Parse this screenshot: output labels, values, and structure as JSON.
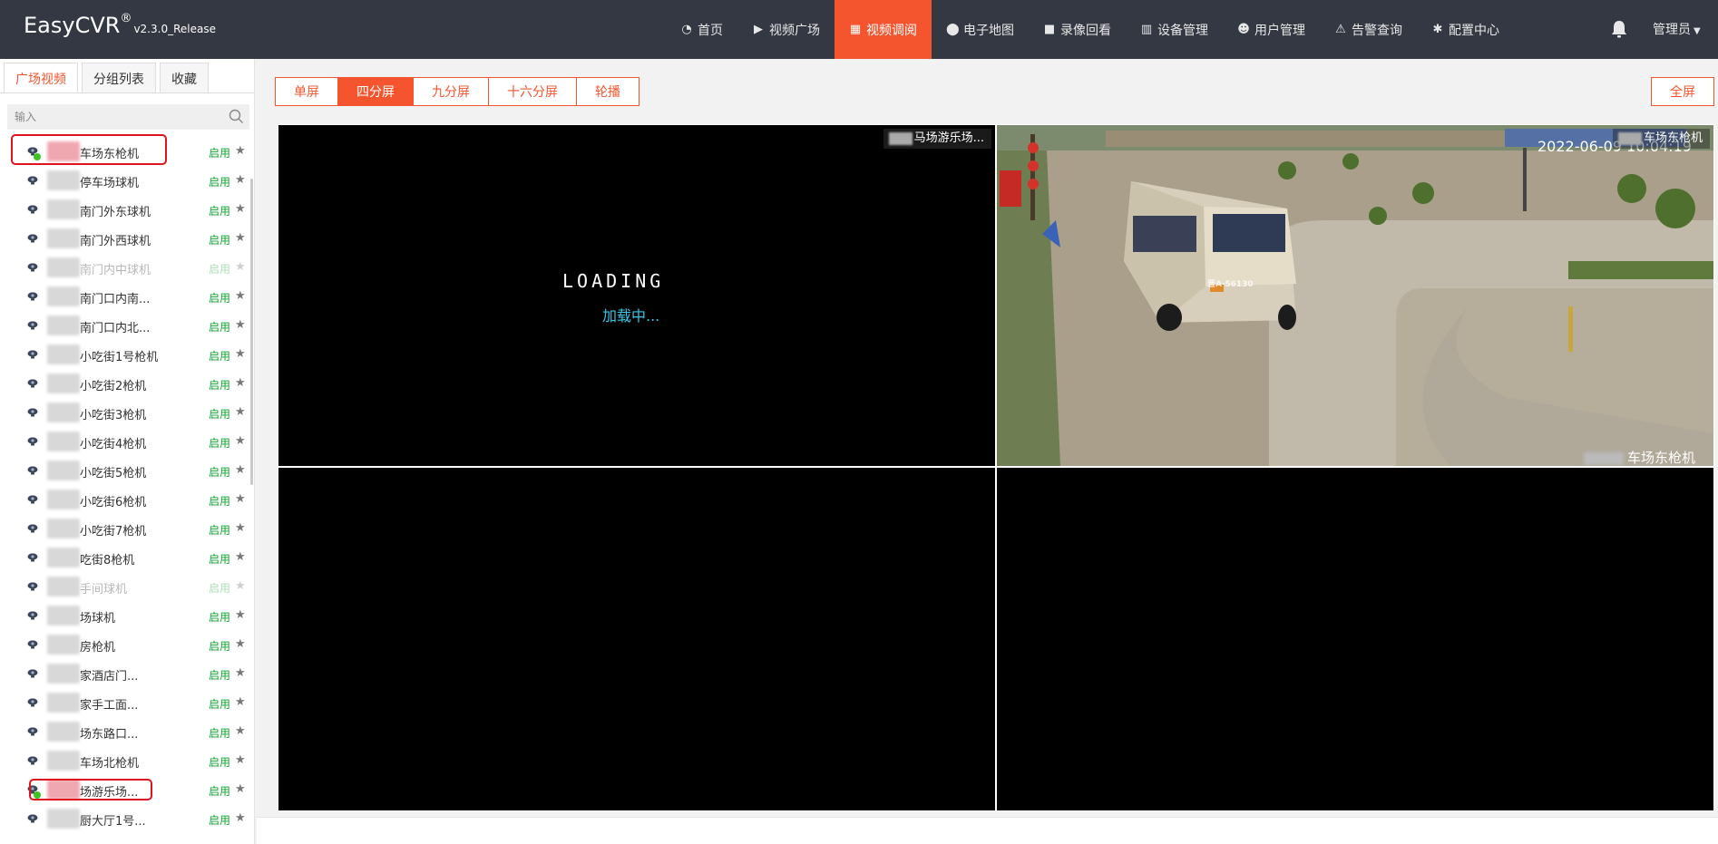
{
  "app": {
    "logo": "EasyCVR",
    "logo_mark": "®",
    "version": "v2.3.0_Release"
  },
  "nav": {
    "items": [
      {
        "label": "首页",
        "icon": "dashboard-icon",
        "active": false
      },
      {
        "label": "视频广场",
        "icon": "play-circle-icon",
        "active": false
      },
      {
        "label": "视频调阅",
        "icon": "layout-icon",
        "active": true
      },
      {
        "label": "电子地图",
        "icon": "map-pin-icon",
        "active": false
      },
      {
        "label": "录像回看",
        "icon": "video-camera-icon",
        "active": false
      },
      {
        "label": "设备管理",
        "icon": "device-icon",
        "active": false
      },
      {
        "label": "用户管理",
        "icon": "user-icon",
        "active": false
      },
      {
        "label": "告警查询",
        "icon": "alarm-icon",
        "active": false
      },
      {
        "label": "配置中心",
        "icon": "gear-icon",
        "active": false
      }
    ],
    "user": "管理员"
  },
  "sidebar": {
    "tabs": [
      {
        "label": "广场视频",
        "active": true
      },
      {
        "label": "分组列表",
        "active": false
      },
      {
        "label": "收藏",
        "active": false
      }
    ],
    "search_placeholder": "输入",
    "items": [
      {
        "name": "车场东枪机",
        "status": "启用",
        "enabled": true,
        "online": true
      },
      {
        "name": "停车场球机",
        "status": "启用",
        "enabled": true,
        "online": false
      },
      {
        "name": "南门外东球机",
        "status": "启用",
        "enabled": true,
        "online": false
      },
      {
        "name": "南门外西球机",
        "status": "启用",
        "enabled": true,
        "online": false
      },
      {
        "name": "南门内中球机",
        "status": "启用",
        "enabled": false,
        "online": false
      },
      {
        "name": "南门口内南...",
        "status": "启用",
        "enabled": true,
        "online": false
      },
      {
        "name": "南门口内北...",
        "status": "启用",
        "enabled": true,
        "online": false
      },
      {
        "name": "小吃街1号枪机",
        "status": "启用",
        "enabled": true,
        "online": false
      },
      {
        "name": "小吃街2枪机",
        "status": "启用",
        "enabled": true,
        "online": false
      },
      {
        "name": "小吃街3枪机",
        "status": "启用",
        "enabled": true,
        "online": false
      },
      {
        "name": "小吃街4枪机",
        "status": "启用",
        "enabled": true,
        "online": false
      },
      {
        "name": "小吃街5枪机",
        "status": "启用",
        "enabled": true,
        "online": false
      },
      {
        "name": "小吃街6枪机",
        "status": "启用",
        "enabled": true,
        "online": false
      },
      {
        "name": "小吃街7枪机",
        "status": "启用",
        "enabled": true,
        "online": false
      },
      {
        "name": "吃街8枪机",
        "status": "启用",
        "enabled": true,
        "online": false
      },
      {
        "name": "手间球机",
        "status": "启用",
        "enabled": false,
        "online": false
      },
      {
        "name": "场球机",
        "status": "启用",
        "enabled": true,
        "online": false
      },
      {
        "name": "房枪机",
        "status": "启用",
        "enabled": true,
        "online": false
      },
      {
        "name": "家酒店门...",
        "status": "启用",
        "enabled": true,
        "online": false
      },
      {
        "name": "家手工面...",
        "status": "启用",
        "enabled": true,
        "online": false
      },
      {
        "name": "场东路口...",
        "status": "启用",
        "enabled": true,
        "online": false
      },
      {
        "name": "车场北枪机",
        "status": "启用",
        "enabled": true,
        "online": false
      },
      {
        "name": "场游乐场...",
        "status": "启用",
        "enabled": true,
        "online": true
      },
      {
        "name": "厨大厅1号...",
        "status": "启用",
        "enabled": true,
        "online": false
      }
    ]
  },
  "toolbar": {
    "modes": [
      {
        "label": "单屏",
        "active": false
      },
      {
        "label": "四分屏",
        "active": true
      },
      {
        "label": "九分屏",
        "active": false
      },
      {
        "label": "十六分屏",
        "active": false
      },
      {
        "label": "轮播",
        "active": false
      }
    ],
    "fullscreen": "全屏"
  },
  "players": {
    "p1": {
      "label": "马场游乐场...",
      "loading_art": "LOADING",
      "loading_text": "加载中..."
    },
    "p2": {
      "label": "车场东枪机",
      "timestamp": "2022-06-09 10:04:19",
      "bottom_label": "车场东枪机",
      "plate": "晋A·56130"
    }
  },
  "colors": {
    "accent": "#f5552e",
    "topbar": "#343842",
    "enabled": "#0ea52f",
    "loading": "#34c8e6",
    "highlight": "#e0141e"
  }
}
